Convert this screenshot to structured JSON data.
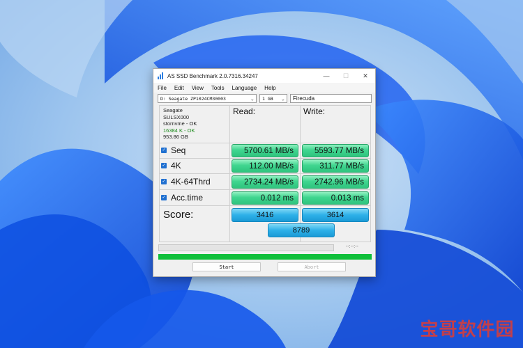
{
  "window": {
    "title": "AS SSD Benchmark 2.0.7316.34247",
    "controls": {
      "minimize": "—",
      "maximize": "☐",
      "close": "✕"
    }
  },
  "menu": [
    "File",
    "Edit",
    "View",
    "Tools",
    "Language",
    "Help"
  ],
  "selectors": {
    "drive": "D: Seagate ZP1024CM30003",
    "size": "1 GB",
    "name": "Firecuda"
  },
  "device": {
    "vendor": "Seagate",
    "firmware": "SULSX000",
    "driver": "stornvme - OK",
    "alignment": "16384 K - OK",
    "capacity": "953.86 GB"
  },
  "columns": {
    "read": "Read:",
    "write": "Write:"
  },
  "rows": [
    {
      "label": "Seq",
      "read": "5700.61 MB/s",
      "write": "5593.77 MB/s",
      "checked": true
    },
    {
      "label": "4K",
      "read": "112.00 MB/s",
      "write": "311.77 MB/s",
      "checked": true
    },
    {
      "label": "4K-64Thrd",
      "read": "2734.24 MB/s",
      "write": "2742.96 MB/s",
      "checked": true
    },
    {
      "label": "Acc.time",
      "read": "0.012 ms",
      "write": "0.013 ms",
      "checked": true
    }
  ],
  "score": {
    "label": "Score:",
    "read": "3416",
    "write": "3614",
    "total": "8789"
  },
  "progress": {
    "time": "--:--:--",
    "complete_fraction": 1.0
  },
  "buttons": {
    "start": "Start",
    "abort": "Abort"
  },
  "watermark": "宝哥软件园",
  "colors": {
    "result_green": "#3fd58f",
    "score_blue": "#2db0e8",
    "progress_green": "#0fbf3a",
    "checkbox_blue": "#2070d0"
  }
}
